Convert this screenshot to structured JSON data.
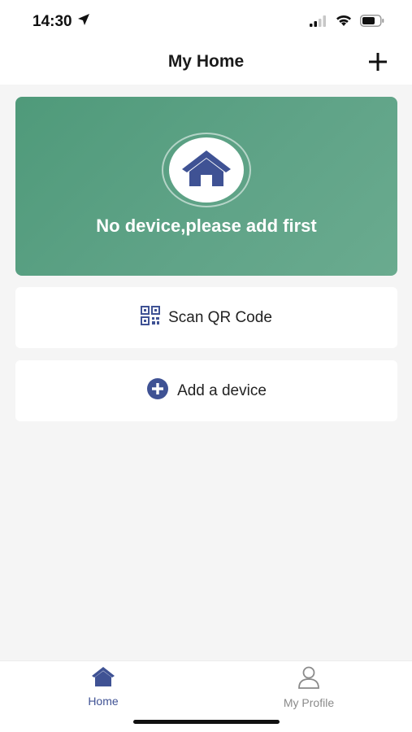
{
  "status_bar": {
    "time": "14:30",
    "icons": [
      "location-arrow-icon",
      "cellular-signal-icon",
      "wifi-icon",
      "battery-icon"
    ]
  },
  "header": {
    "title": "My Home",
    "add_icon": "plus-icon"
  },
  "banner": {
    "message": "No device,please add first",
    "icon": "house-icon",
    "color": "#5fa387"
  },
  "actions": {
    "scan": {
      "label": "Scan QR Code",
      "icon": "qr-code-icon"
    },
    "add_device": {
      "label": "Add a device",
      "icon": "plus-circle-icon"
    }
  },
  "tabbar": {
    "tabs": [
      {
        "label": "Home",
        "icon": "house-icon",
        "active": true
      },
      {
        "label": "My Profile",
        "icon": "person-icon",
        "active": false
      }
    ]
  },
  "colors": {
    "accent": "#3f5294",
    "inactive": "#8a8a8a",
    "banner": "#5fa387",
    "background": "#f5f5f5"
  }
}
